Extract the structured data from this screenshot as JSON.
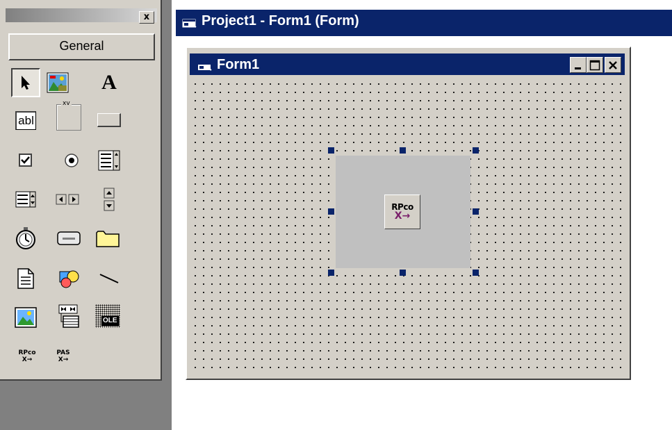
{
  "toolbox": {
    "close_label": "x",
    "tab_label": "General",
    "tools": [
      {
        "name": "pointer-icon"
      },
      {
        "name": "picturebox-icon"
      },
      {
        "name": "label-icon",
        "glyph": "A"
      },
      {
        "name": "textbox-icon",
        "glyph": "abl"
      },
      {
        "name": "frame-icon",
        "glyph": "xv"
      },
      {
        "name": "commandbutton-icon"
      },
      {
        "name": "checkbox-icon"
      },
      {
        "name": "optionbutton-icon"
      },
      {
        "name": "combobox-icon"
      },
      {
        "name": "listbox-icon"
      },
      {
        "name": "hscrollbar-icon"
      },
      {
        "name": "vscrollbar-icon"
      },
      {
        "name": "timer-icon"
      },
      {
        "name": "drivelistbox-icon"
      },
      {
        "name": "dirlistbox-icon"
      },
      {
        "name": "filelistbox-icon"
      },
      {
        "name": "shape-icon"
      },
      {
        "name": "line-icon"
      },
      {
        "name": "image-icon"
      },
      {
        "name": "data-icon"
      },
      {
        "name": "ole-icon",
        "glyph": "OLE"
      },
      {
        "name": "rpco-icon",
        "glyph_top": "RPco",
        "glyph_bottom": "X→"
      },
      {
        "name": "pas-icon",
        "glyph_top": "PAS",
        "glyph_bottom": "X→"
      }
    ]
  },
  "designer": {
    "window_title": "Project1 - Form1 (Form)",
    "form_title": "Form1",
    "control": {
      "icon_top": "RPco",
      "icon_bottom": "X→"
    }
  },
  "colors": {
    "titlebar": "#0a246a",
    "face": "#d4d0c8",
    "control_bg": "#c0c0c0",
    "handle": "#0a246a"
  }
}
